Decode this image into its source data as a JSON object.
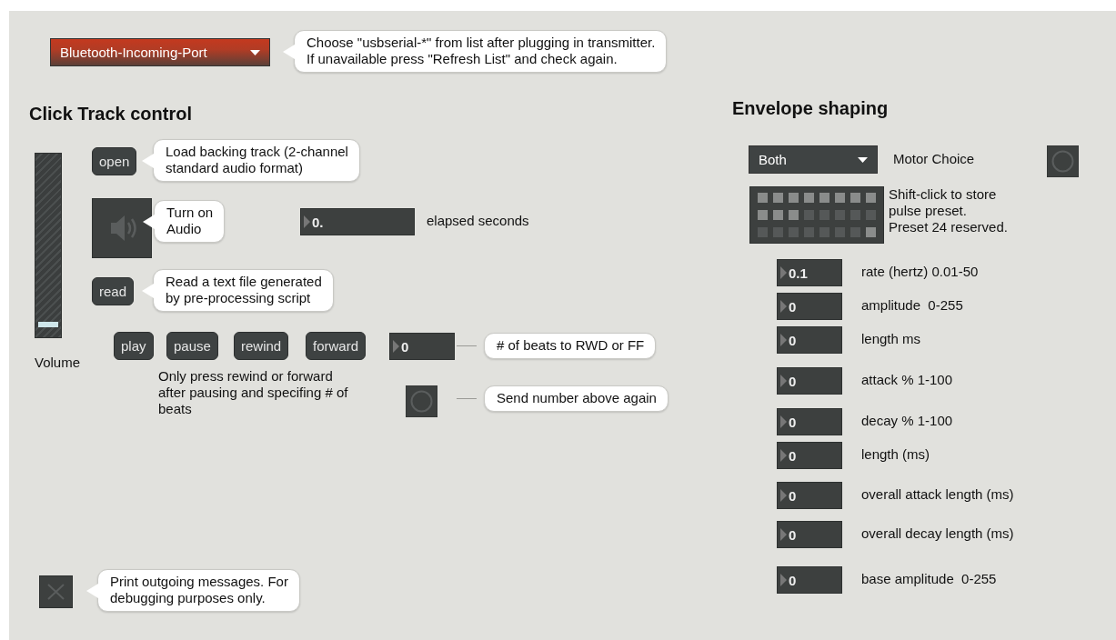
{
  "port_menu": {
    "value": "Bluetooth-Incoming-Port"
  },
  "port_hint": {
    "kind": "tail",
    "text": "Choose \"usbserial-*\" from list after plugging in transmitter.\nIf unavailable press \"Refresh List\" and check again."
  },
  "click_track": {
    "heading": "Click Track control",
    "volume": {
      "label": "Volume",
      "level": 0.04
    },
    "open_button": "open",
    "open_hint": {
      "kind": "tail",
      "text": "Load backing track (2-channel\nstandard audio format)"
    },
    "audio_toggle": {
      "on": false
    },
    "audio_hint": {
      "kind": "tail",
      "text": "Turn on\nAudio"
    },
    "elapsed": {
      "value": "0.",
      "label": "elapsed seconds"
    },
    "read_button": "read",
    "read_hint": {
      "kind": "tail",
      "text": "Read a text file generated\nby pre-processing script"
    },
    "transport": [
      "play",
      "pause",
      "rewind",
      "forward"
    ],
    "beats": {
      "value": "0"
    },
    "beats_hint": {
      "kind": "line",
      "text": "# of beats to RWD or FF"
    },
    "note": "Only press rewind or forward\nafter pausing and specifing # of\nbeats",
    "resend_hint": {
      "kind": "line",
      "text": "Send number above again"
    }
  },
  "print_toggle": {
    "on": false
  },
  "print_hint": {
    "kind": "tail",
    "text": "Print outgoing messages. For\ndebugging purposes only."
  },
  "envelope": {
    "heading": "Envelope shaping",
    "motor_menu": {
      "value": "Both"
    },
    "motor_label": "Motor Choice",
    "preset_slots": [
      {
        "stored": true
      },
      {
        "stored": true
      },
      {
        "stored": true
      },
      {
        "stored": true
      },
      {
        "stored": true
      },
      {
        "stored": true
      },
      {
        "stored": true
      },
      {
        "stored": true
      },
      {
        "stored": true
      },
      {
        "stored": true
      },
      {
        "stored": true
      },
      {
        "stored": false
      },
      {
        "stored": false
      },
      {
        "stored": false
      },
      {
        "stored": false
      },
      {
        "stored": false
      },
      {
        "stored": false
      },
      {
        "stored": false
      },
      {
        "stored": false
      },
      {
        "stored": false
      },
      {
        "stored": false
      },
      {
        "stored": false
      },
      {
        "stored": false
      },
      {
        "stored": true
      }
    ],
    "preset_hint": "Shift-click to store\npulse preset.\nPreset 24 reserved.",
    "params": [
      {
        "value": "0.1",
        "label": "rate (hertz) 0.01-50"
      },
      {
        "value": "0",
        "label": "amplitude  0-255"
      },
      {
        "value": "0",
        "label": "length ms"
      },
      {
        "value": "0",
        "label": "attack % 1-100"
      },
      {
        "value": "0",
        "label": "decay % 1-100"
      },
      {
        "value": "0",
        "label": "length (ms)"
      },
      {
        "value": "0",
        "label": "overall attack length (ms)"
      },
      {
        "value": "0",
        "label": "overall decay length (ms)"
      },
      {
        "value": "0",
        "label": "base amplitude  0-255"
      }
    ]
  }
}
